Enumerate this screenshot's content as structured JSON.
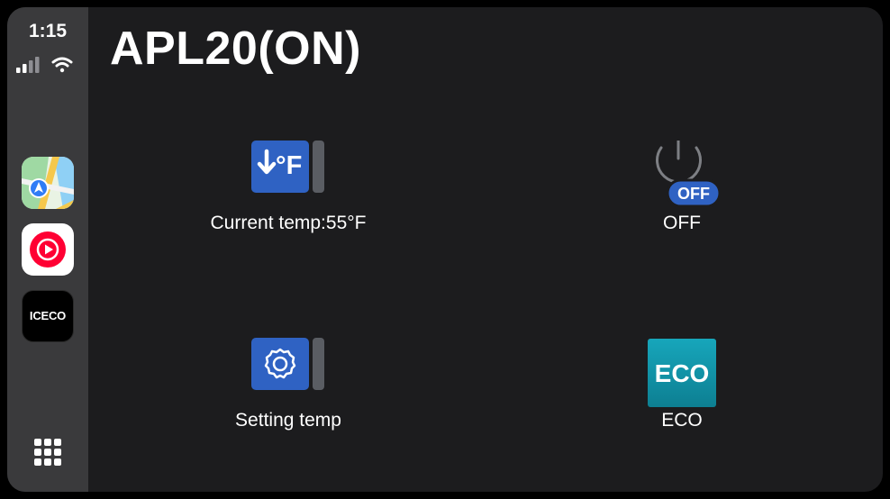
{
  "status": {
    "time": "1:15"
  },
  "dock": {
    "apps": [
      {
        "name": "Maps"
      },
      {
        "name": "YouTube Music"
      },
      {
        "name": "ICECO",
        "label": "ICECO"
      }
    ]
  },
  "header": {
    "title": "APL20(ON)"
  },
  "controls": {
    "current_temp": {
      "label": "Current temp:55°F",
      "unit_glyph": "°F"
    },
    "power": {
      "label": "OFF",
      "badge": "OFF"
    },
    "setting_temp": {
      "label": "Setting temp"
    },
    "eco": {
      "label": "ECO",
      "badge": "ECO"
    }
  },
  "colors": {
    "background": "#1c1c1e",
    "sidebar": "#3a3a3c",
    "tile_blue": "#2f62c3",
    "eco_teal": "#1395ab"
  }
}
